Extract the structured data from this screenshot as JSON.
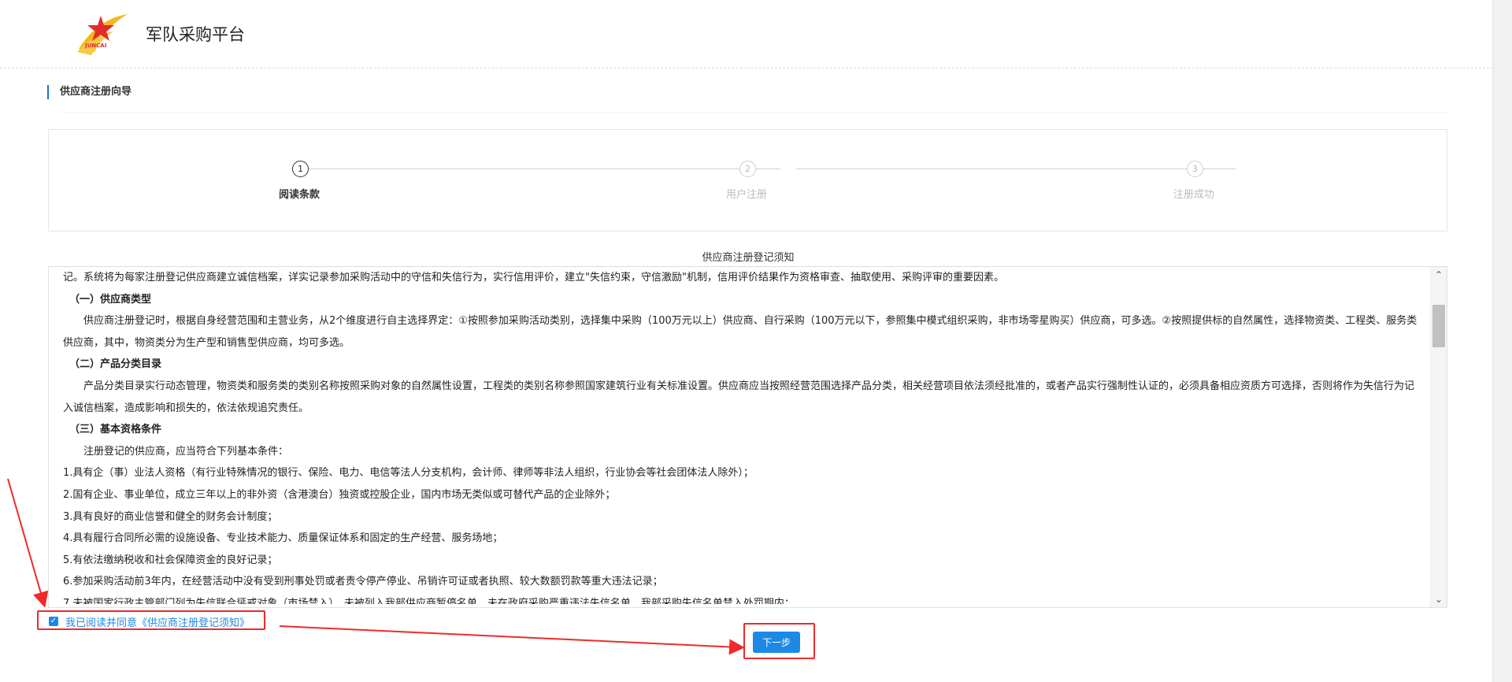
{
  "header": {
    "app_title": "军队采购平台",
    "logo_text": "JUNCAI",
    "colors": {
      "star": "#e12b2b",
      "swoosh": "#f3b81c"
    }
  },
  "section": {
    "title": "供应商注册向导"
  },
  "steps": [
    {
      "number": "1",
      "label": "阅读条款",
      "state": "active"
    },
    {
      "number": "2",
      "label": "用户注册",
      "state": "inactive"
    },
    {
      "number": "3",
      "label": "注册成功",
      "state": "inactive"
    }
  ],
  "notice": {
    "title": "供应商注册登记须知",
    "paragraphs": [
      "记。系统将为每家注册登记供应商建立诚信档案，详实记录参加采购活动中的守信和失信行为，实行信用评价，建立\"失信约束，守信激励\"机制，信用评价结果作为资格审查、抽取使用、采购评审的重要因素。",
      "（一）供应商类型",
      "供应商注册登记时，根据自身经营范围和主营业务，从2个维度进行自主选择界定：①按照参加采购活动类别，选择集中采购（100万元以上）供应商、自行采购（100万元以下，参照集中模式组织采购，非市场零星购买）供应商，可多选。②按照提供标的自然属性，选择物资类、工程类、服务类供应商，其中，物资类分为生产型和销售型供应商，均可多选。",
      "（二）产品分类目录",
      "产品分类目录实行动态管理，物资类和服务类的类别名称按照采购对象的自然属性设置，工程类的类别名称参照国家建筑行业有关标准设置。供应商应当按照经营范围选择产品分类，相关经营项目依法须经批准的，或者产品实行强制性认证的，必须具备相应资质方可选择，否则将作为失信行为记入诚信档案，造成影响和损失的，依法依规追究责任。",
      "（三）基本资格条件",
      "注册登记的供应商，应当符合下列基本条件：",
      "1.具有企（事）业法人资格（有行业特殊情况的银行、保险、电力、电信等法人分支机构，会计师、律师等非法人组织，行业协会等社会团体法人除外）；",
      "2.国有企业、事业单位，成立三年以上的非外资（含港澳台）独资或控股企业，国内市场无类似或可替代产品的企业除外；",
      "3.具有良好的商业信誉和健全的财务会计制度；",
      "4.具有履行合同所必需的设施设备、专业技术能力、质量保证体系和固定的生产经营、服务场地；",
      "5.有依法缴纳税收和社会保障资金的良好记录；",
      "6.参加采购活动前3年内，在经营活动中没有受到刑事处罚或者责令停产停业、吊销许可证或者执照、较大数额罚款等重大违法记录；",
      "7.未被国家行政主管部门列为失信联合惩戒对象（市场禁入），未被列入我部供应商暂停名单、未在政府采购严重违法失信名单、我部采购失信名单禁入处罚期内；"
    ]
  },
  "agree": {
    "label": "我已阅读并同意《供应商注册登记须知》",
    "checked": true
  },
  "buttons": {
    "next_label": "下一步"
  }
}
